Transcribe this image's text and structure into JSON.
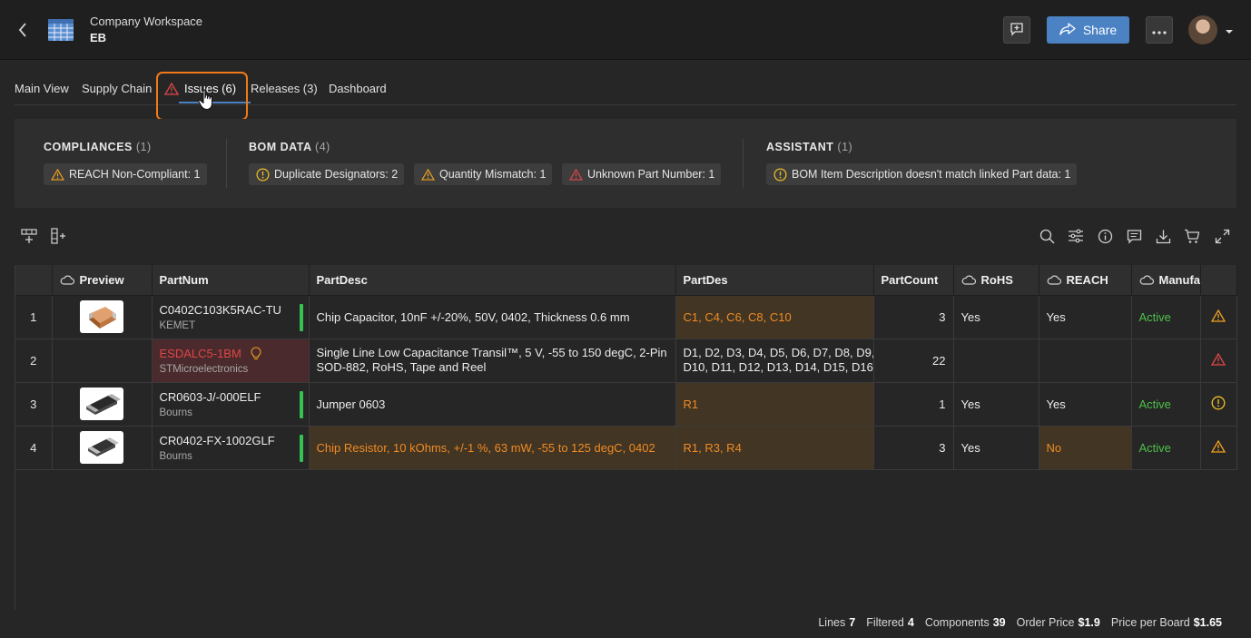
{
  "header": {
    "workspace": "Company Workspace",
    "project": "EB",
    "share_label": "Share"
  },
  "tabs": [
    {
      "label": "Main View"
    },
    {
      "label": "Supply Chain"
    },
    {
      "label": "Issues (6)",
      "active": true
    },
    {
      "label": "Releases (3)"
    },
    {
      "label": "Dashboard"
    }
  ],
  "issues": {
    "compliances": {
      "title": "COMPLIANCES",
      "count": "(1)",
      "chips": [
        {
          "label": "REACH Non-Compliant: 1",
          "icon": "warning-triangle-icon"
        }
      ]
    },
    "bom_data": {
      "title": "BOM DATA",
      "count": "(4)",
      "chips": [
        {
          "label": "Duplicate Designators: 2",
          "icon": "warning-circle-icon"
        },
        {
          "label": "Quantity Mismatch: 1",
          "icon": "warning-triangle-icon"
        },
        {
          "label": "Unknown Part Number: 1",
          "icon": "error-triangle-icon"
        }
      ]
    },
    "assistant": {
      "title": "ASSISTANT",
      "count": "(1)",
      "chips": [
        {
          "label": "BOM Item Description doesn't match linked Part data: 1",
          "icon": "warning-circle-icon"
        }
      ]
    }
  },
  "table": {
    "columns": [
      "Preview",
      "PartNum",
      "PartDesc",
      "PartDes",
      "PartCount",
      "RoHS",
      "REACH",
      "Manufa"
    ],
    "rows": [
      {
        "num": "1",
        "part_num": "C0402C103K5RAC-TU",
        "manufacturer": "KEMET",
        "desc": "Chip Capacitor, 10nF +/-20%, 50V, 0402, Thickness 0.6 mm",
        "des": "C1, C4, C6, C8, C10",
        "count": "3",
        "rohs": "Yes",
        "reach": "Yes",
        "lifecycle": "Active",
        "issue_icon": "warning-triangle-icon"
      },
      {
        "num": "2",
        "part_num": "ESDALC5-1BM",
        "manufacturer": "STMicroelectronics",
        "desc_line1": "Single Line Low Capacitance Transil™, 5 V, -55 to 150 degC, 2-Pin",
        "desc_line2": "SOD-882, RoHS, Tape and Reel",
        "des_line1": "D1, D2, D3, D4, D5, D6, D7, D8, D9,",
        "des_line2": "D10, D11, D12, D13, D14, D15, D16…",
        "count": "22",
        "rohs": "",
        "reach": "",
        "lifecycle": "",
        "issue_icon": "error-triangle-icon"
      },
      {
        "num": "3",
        "part_num": "CR0603-J/-000ELF",
        "manufacturer": "Bourns",
        "desc": "Jumper 0603",
        "des": "R1",
        "count": "1",
        "rohs": "Yes",
        "reach": "Yes",
        "lifecycle": "Active",
        "issue_icon": "warning-circle-icon"
      },
      {
        "num": "4",
        "part_num": "CR0402-FX-1002GLF",
        "manufacturer": "Bourns",
        "desc": "Chip Resistor, 10 kOhms, +/-1 %, 63 mW, -55 to 125 degC, 0402",
        "des": "R1, R3, R4",
        "count": "3",
        "rohs": "Yes",
        "reach": "No",
        "lifecycle": "Active",
        "issue_icon": "warning-triangle-icon"
      }
    ]
  },
  "footer": {
    "lines_label": "Lines",
    "lines": "7",
    "filtered_label": "Filtered",
    "filtered": "4",
    "components_label": "Components",
    "components": "39",
    "order_price_label": "Order Price",
    "order_price": "$1.9",
    "ppb_label": "Price per Board",
    "ppb": "$1.65"
  },
  "colors": {
    "accent": "#4a82c4",
    "warning": "#f0a020",
    "error": "#e04646",
    "active": "#4ec04a",
    "highlight": "#f07a18"
  }
}
